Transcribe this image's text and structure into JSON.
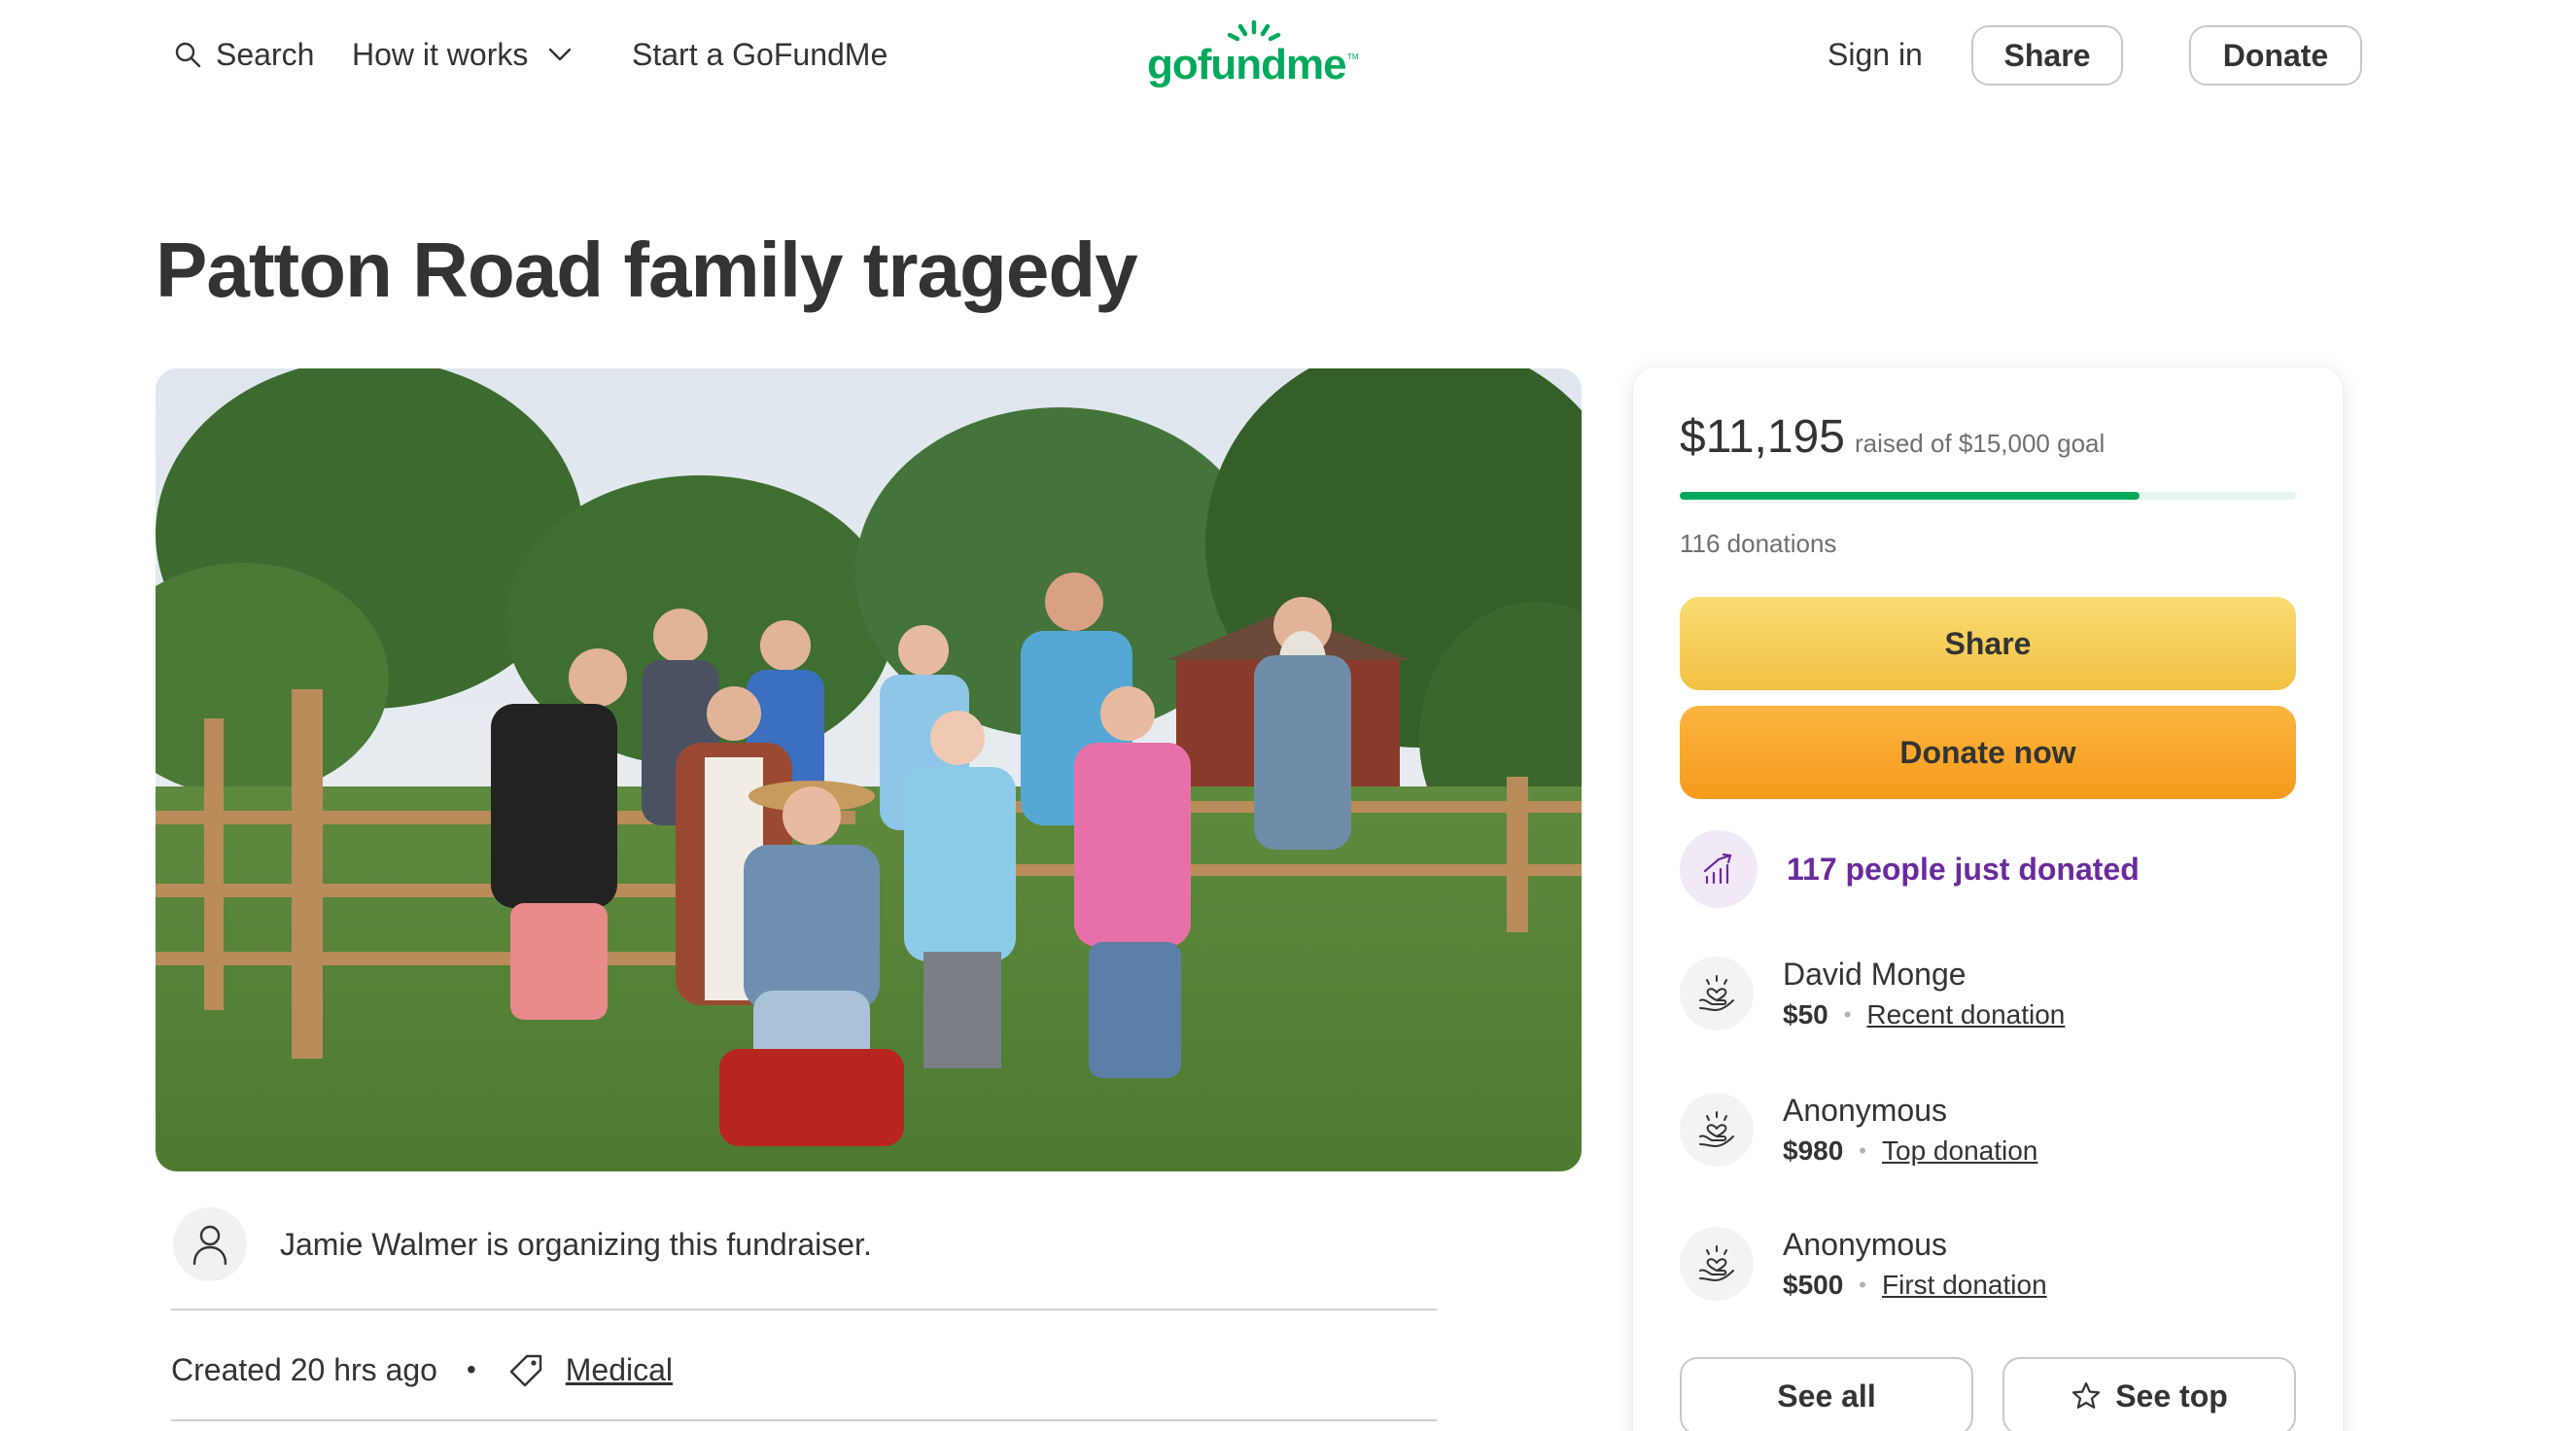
{
  "header": {
    "search_label": "Search",
    "how_it_works_label": "How it works",
    "start_label": "Start a GoFundMe",
    "logo_text": "gofundme",
    "logo_tm": "TM",
    "sign_in_label": "Sign in",
    "share_label": "Share",
    "donate_label": "Donate"
  },
  "campaign": {
    "title": "Patton Road family tragedy",
    "organizer_text": "Jamie Walmer is organizing this fundraiser.",
    "created_text": "Created 20 hrs ago",
    "separator": "•",
    "category": "Medical"
  },
  "card": {
    "raised_amount": "$11,195",
    "raised_goal_text": "raised of $15,000 goal",
    "progress_fraction": 0.746,
    "donation_count_text": "116 donations",
    "share_button": "Share",
    "donate_button": "Donate now",
    "trend_text": "117 people just donated",
    "donations": [
      {
        "name": "David Monge",
        "amount": "$50",
        "tag": "Recent donation"
      },
      {
        "name": "Anonymous",
        "amount": "$980",
        "tag": "Top donation"
      },
      {
        "name": "Anonymous",
        "amount": "$500",
        "tag": "First donation"
      }
    ],
    "see_all_label": "See all",
    "see_top_label": "See top"
  },
  "colors": {
    "brand_green": "#02a95c",
    "share_yellow": "#f2c143",
    "donate_orange": "#f59a1c",
    "trend_purple": "#6a2a9c"
  },
  "icons": {
    "search": "search-icon",
    "chevron": "chevron-down-icon",
    "organizer": "user-icon",
    "category": "tag-icon",
    "trend": "trending-up-icon",
    "donor": "heart-hand-icon",
    "see_top": "star-icon"
  }
}
